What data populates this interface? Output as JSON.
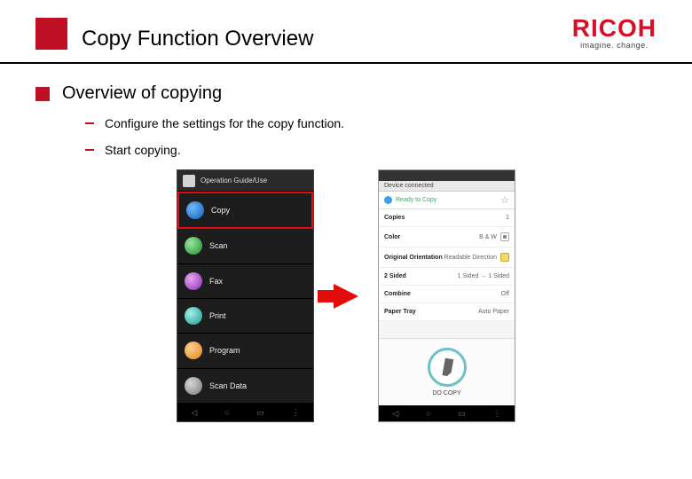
{
  "header": {
    "title": "Copy Function Overview",
    "logo": {
      "brand": "RICOH",
      "tagline": "imagine. change."
    }
  },
  "section": {
    "title": "Overview of copying",
    "bullets": [
      "Configure the settings for the copy function.",
      "Start copying."
    ]
  },
  "left_phone": {
    "app_name": "Operation Guide/Use",
    "items": [
      {
        "label": "Copy",
        "icon": "blue",
        "highlight": true
      },
      {
        "label": "Scan",
        "icon": "green",
        "highlight": false
      },
      {
        "label": "Fax",
        "icon": "purple",
        "highlight": false
      },
      {
        "label": "Print",
        "icon": "teal",
        "highlight": false
      },
      {
        "label": "Program",
        "icon": "orange",
        "highlight": false
      },
      {
        "label": "Scan Data",
        "icon": "grey",
        "highlight": false
      }
    ]
  },
  "right_phone": {
    "screen_title": "Device connected",
    "status": "Ready to Copy",
    "rows": [
      {
        "label": "Copies",
        "value": "1",
        "badge": null
      },
      {
        "label": "Color",
        "value": "B & W",
        "badge": "bw"
      },
      {
        "label": "Original Orientation",
        "value": "Readable Direction",
        "badge": "y"
      },
      {
        "label": "2 Sided",
        "value": "1 Sided → 1 Sided",
        "badge": null
      },
      {
        "label": "Combine",
        "value": "Off",
        "badge": null
      },
      {
        "label": "Paper Tray",
        "value": "Auto Paper",
        "badge": null
      }
    ],
    "start_label": "DO COPY"
  },
  "nav_glyphs": {
    "back": "◁",
    "home": "○",
    "recent": "▭",
    "menu": "⋮"
  }
}
